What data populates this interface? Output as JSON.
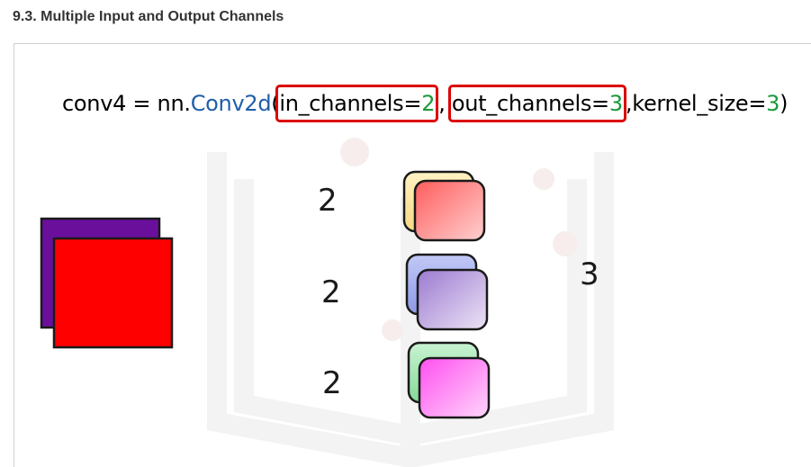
{
  "header": {
    "section_title": "9.3. Multiple Input and Output Channels"
  },
  "code": {
    "var": "conv4 = nn.",
    "fn": "Conv2d",
    "paren_open": "(",
    "in_key": "in_channels=",
    "in_val": "2",
    "sep1": ",",
    "out_key": "out_channels=",
    "out_val": "3",
    "sep2": ",",
    "kernel_key": "kernel_size=",
    "kernel_val": "3",
    "paren_close": ")"
  },
  "labels": {
    "kernel1_channels": "2",
    "kernel2_channels": "2",
    "kernel3_channels": "2",
    "out_channels": "3"
  },
  "colors": {
    "input_back": "#6a0f9c",
    "input_front": "#ff0000",
    "kernel1_back": "#fde7a6",
    "kernel1_front": "#ff7b7b",
    "kernel2_back": "#a9b2ee",
    "kernel2_front": "#b08fd8",
    "kernel3_back": "#a6e6b4",
    "kernel3_front": "#ff66ee",
    "highlight_box": "#dd0000",
    "fn_color": "#1f5ea8",
    "num_color": "#1a9a3a"
  }
}
